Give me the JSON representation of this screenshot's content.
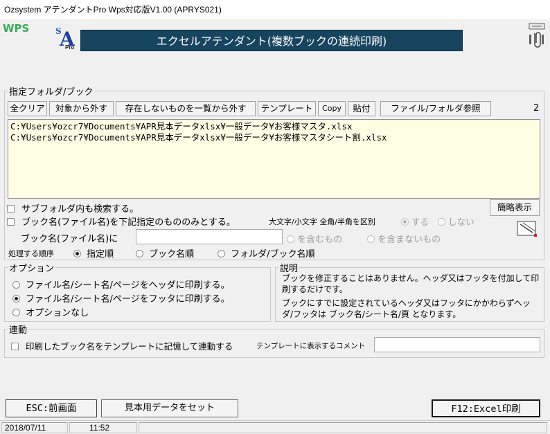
{
  "window": {
    "title": "Ozsystem アテンダントPro Wps対応版V1.00 (APRYS021)"
  },
  "logos": {
    "wps": "WPS",
    "app_s": "S",
    "app_a": "A",
    "app_pro": "Pro"
  },
  "banner": {
    "title": "エクセルアテンダント(複数ブックの連続印刷)"
  },
  "folder": {
    "legend": "指定フォルダ/ブック",
    "buttons": {
      "clear_all": "全クリア",
      "remove": "対象から外す",
      "remove_missing": "存在しないものを一覧から外す",
      "template": "テンプレート",
      "copy": "Copy",
      "paste": "貼付",
      "browse": "ファイル/フォルダ参照"
    },
    "count": "2",
    "items": [
      "C:¥Users¥ozcr7¥Documents¥APR見本データxlsx¥一般データ¥お客様マスタ.xlsx",
      "C:¥Users¥ozcr7¥Documents¥APR見本データxlsx¥一般データ¥お客様マスタシート割.xlsx"
    ],
    "subfolder_label": "サブフォルダ内も検索する。",
    "simple_view_button": "簡略表示",
    "bookname_only_label": "ブック名(ファイル名)を下記指定のもののみとする。",
    "case_label": "大文字/小文字 全角/半角を区別",
    "case_yes": "する",
    "case_no": "しない",
    "bookname_in_label": "ブック名(ファイル名)に",
    "bookname_value": "",
    "contains": "を含むもの",
    "not_contains": "を含まないもの",
    "order_label": "処理する順序",
    "order_options": [
      "指定順",
      "ブック名順",
      "フォルダ/ブック名順"
    ]
  },
  "options": {
    "legend": "オプション",
    "items": [
      "ファイル名/シート名/ページをヘッダに印刷する。",
      "ファイル名/シート名/ページをフッタに印刷する。",
      "オプションなし"
    ]
  },
  "description": {
    "legend": "説明",
    "para1": "ブックを修正することはありません。ヘッダ又はフッタを付加して印刷するだけです。",
    "para2": "ブックにすでに設定されているヘッダ又はフッタにかかわらずヘッダ/フッタは ブック名/シート名/頁 となります。"
  },
  "link": {
    "legend": "連動",
    "checkbox_label": "印刷したブック名をテンプレートに記憶して連動する",
    "comment_label": "テンプレートに表示するコメント",
    "comment_value": ""
  },
  "footer_buttons": {
    "esc": "ESC:前画面",
    "sample": "見本用データをセット",
    "f12": "F12:Excel印刷"
  },
  "statusbar": {
    "date": "2018/07/11",
    "time": "11:52"
  }
}
